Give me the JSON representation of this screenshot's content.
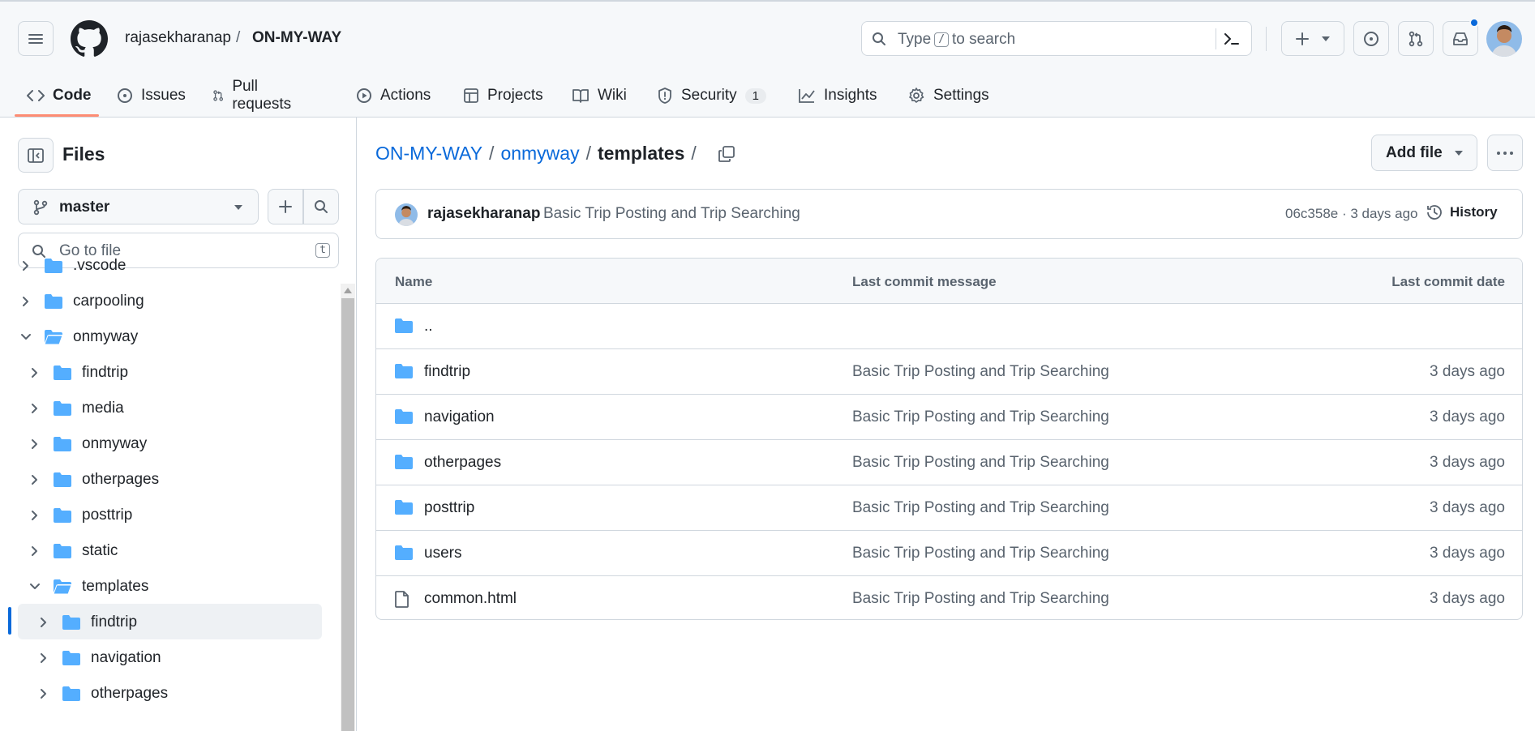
{
  "header": {
    "owner": "rajasekharanap",
    "separator": "/",
    "repo": "ON-MY-WAY",
    "search_prefix": "Type",
    "search_key": "/",
    "search_suffix": "to search"
  },
  "tabs": [
    {
      "label": "Code",
      "icon": "code-icon",
      "active": true
    },
    {
      "label": "Issues",
      "icon": "issue-icon"
    },
    {
      "label": "Pull requests",
      "icon": "pull-request-icon"
    },
    {
      "label": "Actions",
      "icon": "play-icon"
    },
    {
      "label": "Projects",
      "icon": "table-icon"
    },
    {
      "label": "Wiki",
      "icon": "book-icon"
    },
    {
      "label": "Security",
      "icon": "shield-icon",
      "count": "1"
    },
    {
      "label": "Insights",
      "icon": "graph-icon"
    },
    {
      "label": "Settings",
      "icon": "gear-icon"
    }
  ],
  "sidebar": {
    "title": "Files",
    "branch": "master",
    "goto_placeholder": "Go to file",
    "goto_key": "t",
    "tree": [
      {
        "label": ".vscode",
        "expanded": false
      },
      {
        "label": "carpooling",
        "expanded": false
      },
      {
        "label": "onmyway",
        "expanded": true
      },
      {
        "label": "findtrip",
        "expanded": false
      },
      {
        "label": "media",
        "expanded": false
      },
      {
        "label": "onmyway",
        "expanded": false
      },
      {
        "label": "otherpages",
        "expanded": false
      },
      {
        "label": "posttrip",
        "expanded": false
      },
      {
        "label": "static",
        "expanded": false
      },
      {
        "label": "templates",
        "expanded": true,
        "selected": true
      },
      {
        "label": "findtrip",
        "expanded": false
      },
      {
        "label": "navigation",
        "expanded": false
      },
      {
        "label": "otherpages",
        "expanded": false
      }
    ]
  },
  "breadcrumb": {
    "root": "ON-MY-WAY",
    "sep1": "/",
    "folder": "onmyway",
    "sep2": "/",
    "current": "templates",
    "sep3": "/"
  },
  "actions": {
    "add_file": "Add file"
  },
  "commit": {
    "author": "rajasekharanap",
    "message": "Basic Trip Posting and Trip Searching",
    "hash_age": "06c358e · 3 days ago",
    "history": "History"
  },
  "table": {
    "headers": [
      "Name",
      "Last commit message",
      "Last commit date"
    ],
    "rows": [
      {
        "name": "..",
        "type": "folder",
        "message": "",
        "date": ""
      },
      {
        "name": "findtrip",
        "type": "folder",
        "message": "Basic Trip Posting and Trip Searching",
        "date": "3 days ago"
      },
      {
        "name": "navigation",
        "type": "folder",
        "message": "Basic Trip Posting and Trip Searching",
        "date": "3 days ago"
      },
      {
        "name": "otherpages",
        "type": "folder",
        "message": "Basic Trip Posting and Trip Searching",
        "date": "3 days ago"
      },
      {
        "name": "posttrip",
        "type": "folder",
        "message": "Basic Trip Posting and Trip Searching",
        "date": "3 days ago"
      },
      {
        "name": "users",
        "type": "folder",
        "message": "Basic Trip Posting and Trip Searching",
        "date": "3 days ago"
      },
      {
        "name": "common.html",
        "type": "file",
        "message": "Basic Trip Posting and Trip Searching",
        "date": "3 days ago"
      }
    ]
  },
  "colors": {
    "accent_link": "#0969da",
    "folder": "#54aeff",
    "active_tab_underline": "#fd8c73",
    "notification_dot": "#0969da"
  }
}
